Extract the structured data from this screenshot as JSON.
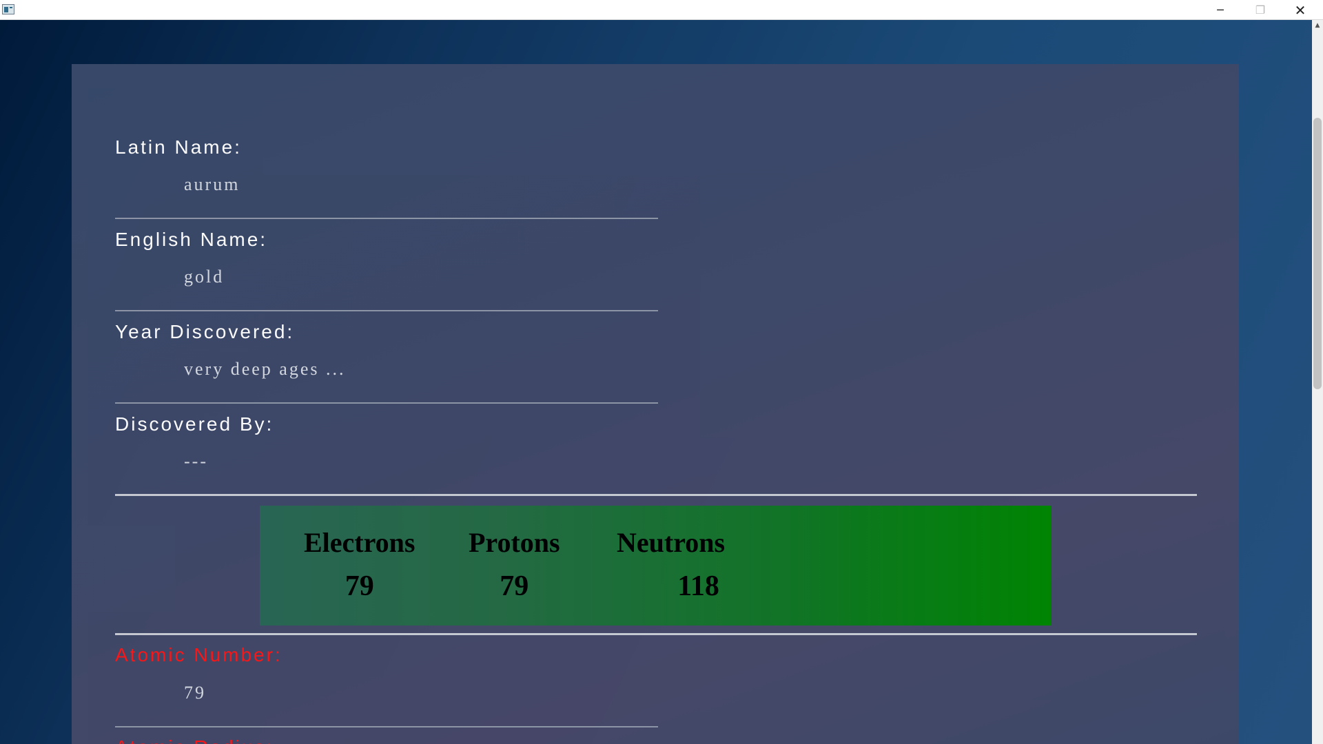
{
  "window": {
    "minimize_icon": "─",
    "maximize_icon": "❐",
    "close_icon": "✕"
  },
  "fields": {
    "latin_name": {
      "label": "Latin Name:",
      "value": "aurum"
    },
    "english_name": {
      "label": "English Name:",
      "value": "gold"
    },
    "year_discovered": {
      "label": "Year Discovered:",
      "value": "very deep ages ..."
    },
    "discovered_by": {
      "label": "Discovered By:",
      "value": "---"
    },
    "atomic_number": {
      "label": "Atomic Number:",
      "value": "79"
    },
    "atomic_radius": {
      "label": "Atomic Radius:"
    }
  },
  "particles": {
    "electrons": {
      "label": "Electrons",
      "value": "79"
    },
    "protons": {
      "label": "Protons",
      "value": "79"
    },
    "neutrons": {
      "label": "Neutrons",
      "value": "118"
    }
  },
  "colors": {
    "label_red": "#ff1616",
    "particles_green": "#008600"
  }
}
